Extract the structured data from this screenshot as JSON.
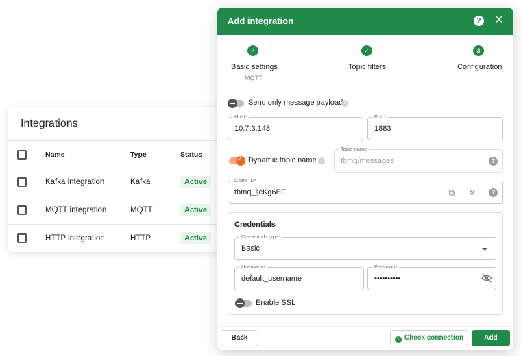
{
  "integrations": {
    "title": "Integrations",
    "columns": [
      "Name",
      "Type",
      "Status"
    ],
    "rows": [
      {
        "name": "Kafka integration",
        "type": "Kafka",
        "status": "Active"
      },
      {
        "name": "MQTT integration",
        "type": "MQTT",
        "status": "Active"
      },
      {
        "name": "HTTP integration",
        "type": "HTTP",
        "status": "Active"
      }
    ]
  },
  "dialog": {
    "title": "Add integration",
    "help_icon": "question-circle-icon",
    "close_icon": "close-icon",
    "steps": [
      {
        "label": "Basic settings",
        "sub": "MQTT",
        "state": "done"
      },
      {
        "label": "Topic filters",
        "sub": "",
        "state": "done"
      },
      {
        "label": "Configuration",
        "sub": "",
        "number": "3",
        "state": "active"
      }
    ],
    "send_payload": {
      "label": "Send only message payload",
      "checked": false
    },
    "host": {
      "label": "Host*",
      "value": "10.7.3.148"
    },
    "port": {
      "label": "Port*",
      "value": "1883"
    },
    "dynamic_topic": {
      "label": "Dynamic topic name",
      "checked": true
    },
    "topic_name": {
      "label": "Topic name",
      "placeholder": "tbmq/messages"
    },
    "client_id": {
      "label": "Client ID*",
      "value": "tbmq_ljcKg6EF"
    },
    "credentials": {
      "title": "Credentials",
      "type": {
        "label": "Credentials type*",
        "value": "Basic"
      },
      "username": {
        "label": "Username",
        "value": "default_username"
      },
      "password": {
        "label": "Password",
        "value": "••••••••••"
      },
      "enable_ssl": {
        "label": "Enable SSL",
        "checked": false
      }
    },
    "footer": {
      "back": "Back",
      "check_connection": "Check connection",
      "add": "Add"
    }
  },
  "colors": {
    "accent": "#208a4a",
    "toggle_on": "#f06a26",
    "badge_bg": "#e8f5e9"
  }
}
